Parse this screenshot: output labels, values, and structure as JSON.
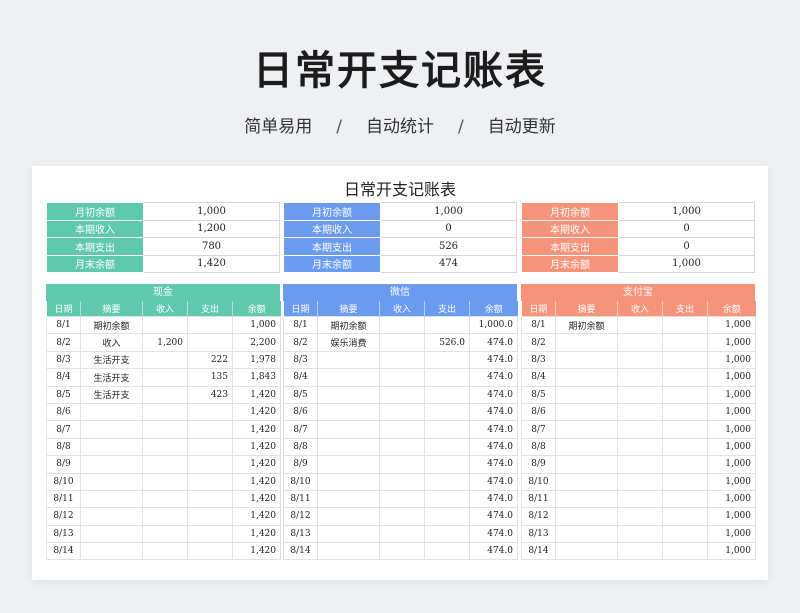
{
  "hero": {
    "title": "日常开支记账表",
    "sub1": "简单易用",
    "sub2": "自动统计",
    "sub3": "自动更新",
    "sep": "/"
  },
  "sheet": {
    "title": "日常开支记账表"
  },
  "colors": {
    "cash": "#5fc9ad",
    "wechat": "#6b9bef",
    "alipay": "#f5947a"
  },
  "summary_labels": [
    "月初余额",
    "本期收入",
    "本期支出",
    "月末余额"
  ],
  "columns": [
    "日期",
    "摘要",
    "收入",
    "支出",
    "余额"
  ],
  "accounts": [
    {
      "name": "现金",
      "summary": [
        "1,000",
        "1,200",
        "780",
        "1,420"
      ],
      "rows": [
        [
          "8/1",
          "期初余额",
          "",
          "",
          "1,000"
        ],
        [
          "8/2",
          "收入",
          "1,200",
          "",
          "2,200"
        ],
        [
          "8/3",
          "生活开支",
          "",
          "222",
          "1,978"
        ],
        [
          "8/4",
          "生活开支",
          "",
          "135",
          "1,843"
        ],
        [
          "8/5",
          "生活开支",
          "",
          "423",
          "1,420"
        ],
        [
          "8/6",
          "",
          "",
          "",
          "1,420"
        ],
        [
          "8/7",
          "",
          "",
          "",
          "1,420"
        ],
        [
          "8/8",
          "",
          "",
          "",
          "1,420"
        ],
        [
          "8/9",
          "",
          "",
          "",
          "1,420"
        ],
        [
          "8/10",
          "",
          "",
          "",
          "1,420"
        ],
        [
          "8/11",
          "",
          "",
          "",
          "1,420"
        ],
        [
          "8/12",
          "",
          "",
          "",
          "1,420"
        ],
        [
          "8/13",
          "",
          "",
          "",
          "1,420"
        ],
        [
          "8/14",
          "",
          "",
          "",
          "1,420"
        ]
      ]
    },
    {
      "name": "微信",
      "summary": [
        "1,000",
        "0",
        "526",
        "474"
      ],
      "rows": [
        [
          "8/1",
          "期初余额",
          "",
          "",
          "1,000.0"
        ],
        [
          "8/2",
          "娱乐消费",
          "",
          "526.0",
          "474.0"
        ],
        [
          "8/3",
          "",
          "",
          "",
          "474.0"
        ],
        [
          "8/4",
          "",
          "",
          "",
          "474.0"
        ],
        [
          "8/5",
          "",
          "",
          "",
          "474.0"
        ],
        [
          "8/6",
          "",
          "",
          "",
          "474.0"
        ],
        [
          "8/7",
          "",
          "",
          "",
          "474.0"
        ],
        [
          "8/8",
          "",
          "",
          "",
          "474.0"
        ],
        [
          "8/9",
          "",
          "",
          "",
          "474.0"
        ],
        [
          "8/10",
          "",
          "",
          "",
          "474.0"
        ],
        [
          "8/11",
          "",
          "",
          "",
          "474.0"
        ],
        [
          "8/12",
          "",
          "",
          "",
          "474.0"
        ],
        [
          "8/13",
          "",
          "",
          "",
          "474.0"
        ],
        [
          "8/14",
          "",
          "",
          "",
          "474.0"
        ]
      ]
    },
    {
      "name": "支付宝",
      "summary": [
        "1,000",
        "0",
        "0",
        "1,000"
      ],
      "rows": [
        [
          "8/1",
          "期初余额",
          "",
          "",
          "1,000"
        ],
        [
          "8/2",
          "",
          "",
          "",
          "1,000"
        ],
        [
          "8/3",
          "",
          "",
          "",
          "1,000"
        ],
        [
          "8/4",
          "",
          "",
          "",
          "1,000"
        ],
        [
          "8/5",
          "",
          "",
          "",
          "1,000"
        ],
        [
          "8/6",
          "",
          "",
          "",
          "1,000"
        ],
        [
          "8/7",
          "",
          "",
          "",
          "1,000"
        ],
        [
          "8/8",
          "",
          "",
          "",
          "1,000"
        ],
        [
          "8/9",
          "",
          "",
          "",
          "1,000"
        ],
        [
          "8/10",
          "",
          "",
          "",
          "1,000"
        ],
        [
          "8/11",
          "",
          "",
          "",
          "1,000"
        ],
        [
          "8/12",
          "",
          "",
          "",
          "1,000"
        ],
        [
          "8/13",
          "",
          "",
          "",
          "1,000"
        ],
        [
          "8/14",
          "",
          "",
          "",
          "1,000"
        ]
      ]
    }
  ]
}
